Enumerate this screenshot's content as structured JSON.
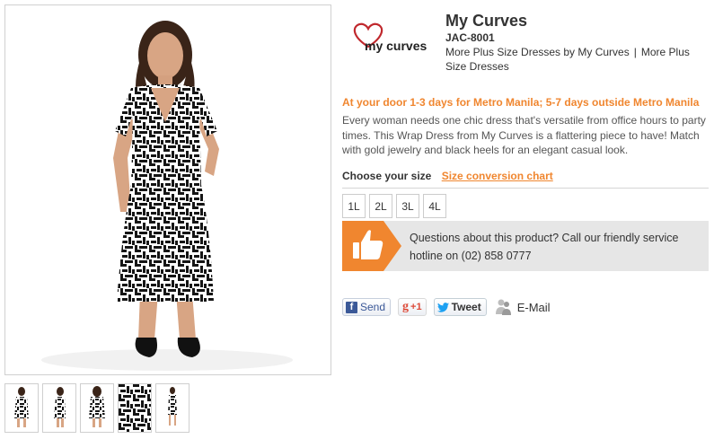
{
  "product": {
    "brand_logo_text": "my curves",
    "title": "My Curves",
    "sku": "JAC-8001",
    "link_brand": "More Plus Size Dresses by My Curves",
    "link_separator": "|",
    "link_category": "More Plus Size Dresses",
    "delivery": "At your door 1-3 days for Metro Manila; 5-7 days outside Metro Manila",
    "description": "Every woman needs one chic dress that's versatile from office hours to party times. This Wrap Dress from My Curves is a flattering piece to have! Match with gold jewelry and black heels for an elegant casual look."
  },
  "sizes": {
    "label": "Choose your size",
    "chart_link": "Size conversion chart",
    "options": [
      "1L",
      "2L",
      "3L",
      "4L"
    ]
  },
  "hotline": {
    "text": "Questions about this product? Call our friendly service hotline on (02) 858 0777"
  },
  "share": {
    "facebook_label": "Send",
    "gplus_label": "+1",
    "twitter_label": "Tweet",
    "email_label": "E-Mail"
  },
  "thumbnails": {
    "count": 5
  },
  "colors": {
    "accent_orange": "#f0862f",
    "hotline_bg": "#e6e6e6",
    "facebook_blue": "#3b5998",
    "twitter_blue": "#1da1f2",
    "gplus_red": "#dd4b39"
  }
}
